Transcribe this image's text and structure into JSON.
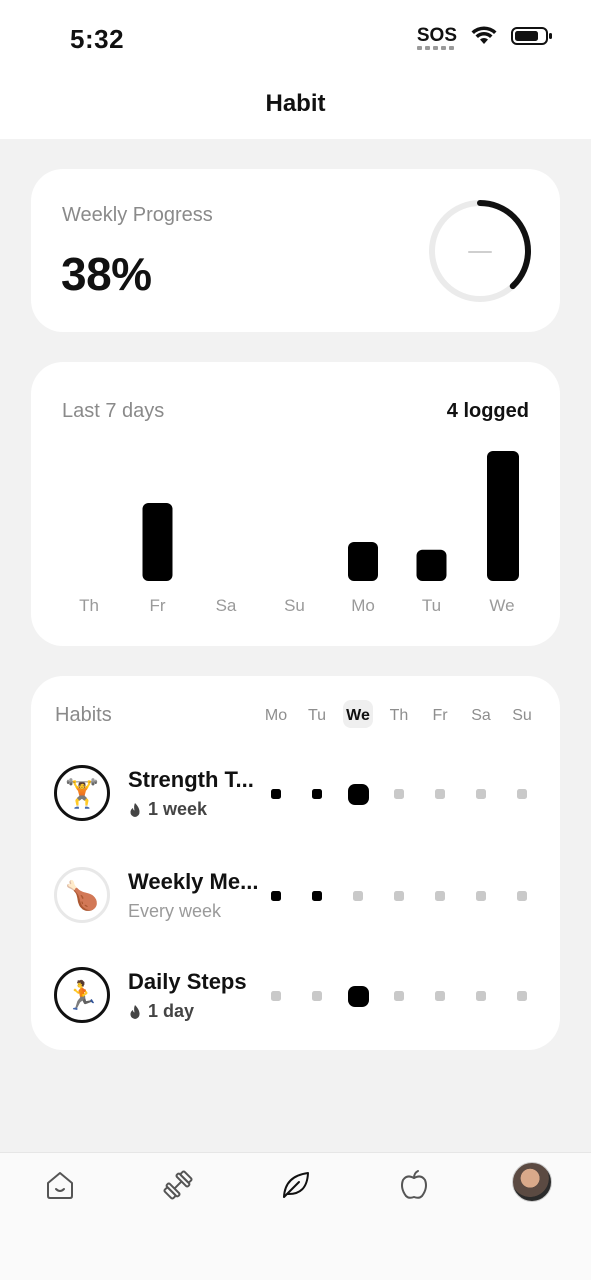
{
  "status_bar": {
    "time": "5:32",
    "sos": "SOS"
  },
  "header": {
    "title": "Habit"
  },
  "weekly_progress": {
    "label": "Weekly Progress",
    "value": "38%",
    "ring_fraction": 0.38
  },
  "last_7_days": {
    "label": "Last 7 days",
    "count": "4 logged",
    "days": [
      "Th",
      "Fr",
      "Sa",
      "Su",
      "Mo",
      "Tu",
      "We"
    ],
    "values": [
      0,
      3,
      0,
      0,
      1.5,
      1.2,
      5
    ]
  },
  "habits": {
    "label": "Habits",
    "days": [
      "Mo",
      "Tu",
      "We",
      "Th",
      "Fr",
      "Sa",
      "Su"
    ],
    "current_day": "We",
    "items": [
      {
        "name": "Strength T...",
        "sub": "1 week",
        "streak": true,
        "icon": "weightlifter-emoji",
        "glyph": "🏋️",
        "checks": [
          1,
          1,
          2,
          0,
          0,
          0,
          0
        ]
      },
      {
        "name": "Weekly Me...",
        "sub": "Every week",
        "streak": false,
        "icon": "drumstick-emoji",
        "glyph": "🍗",
        "checks": [
          1,
          1,
          0,
          0,
          0,
          0,
          0
        ]
      },
      {
        "name": "Daily Steps",
        "sub": "1 day",
        "streak": true,
        "icon": "runner-emoji",
        "glyph": "🏃",
        "checks": [
          0,
          0,
          2,
          0,
          0,
          0,
          0
        ]
      }
    ]
  },
  "bottom_nav": {
    "items": [
      "home-icon",
      "dumbbell-icon",
      "leaf-icon",
      "apple-icon",
      "profile-avatar"
    ]
  }
}
